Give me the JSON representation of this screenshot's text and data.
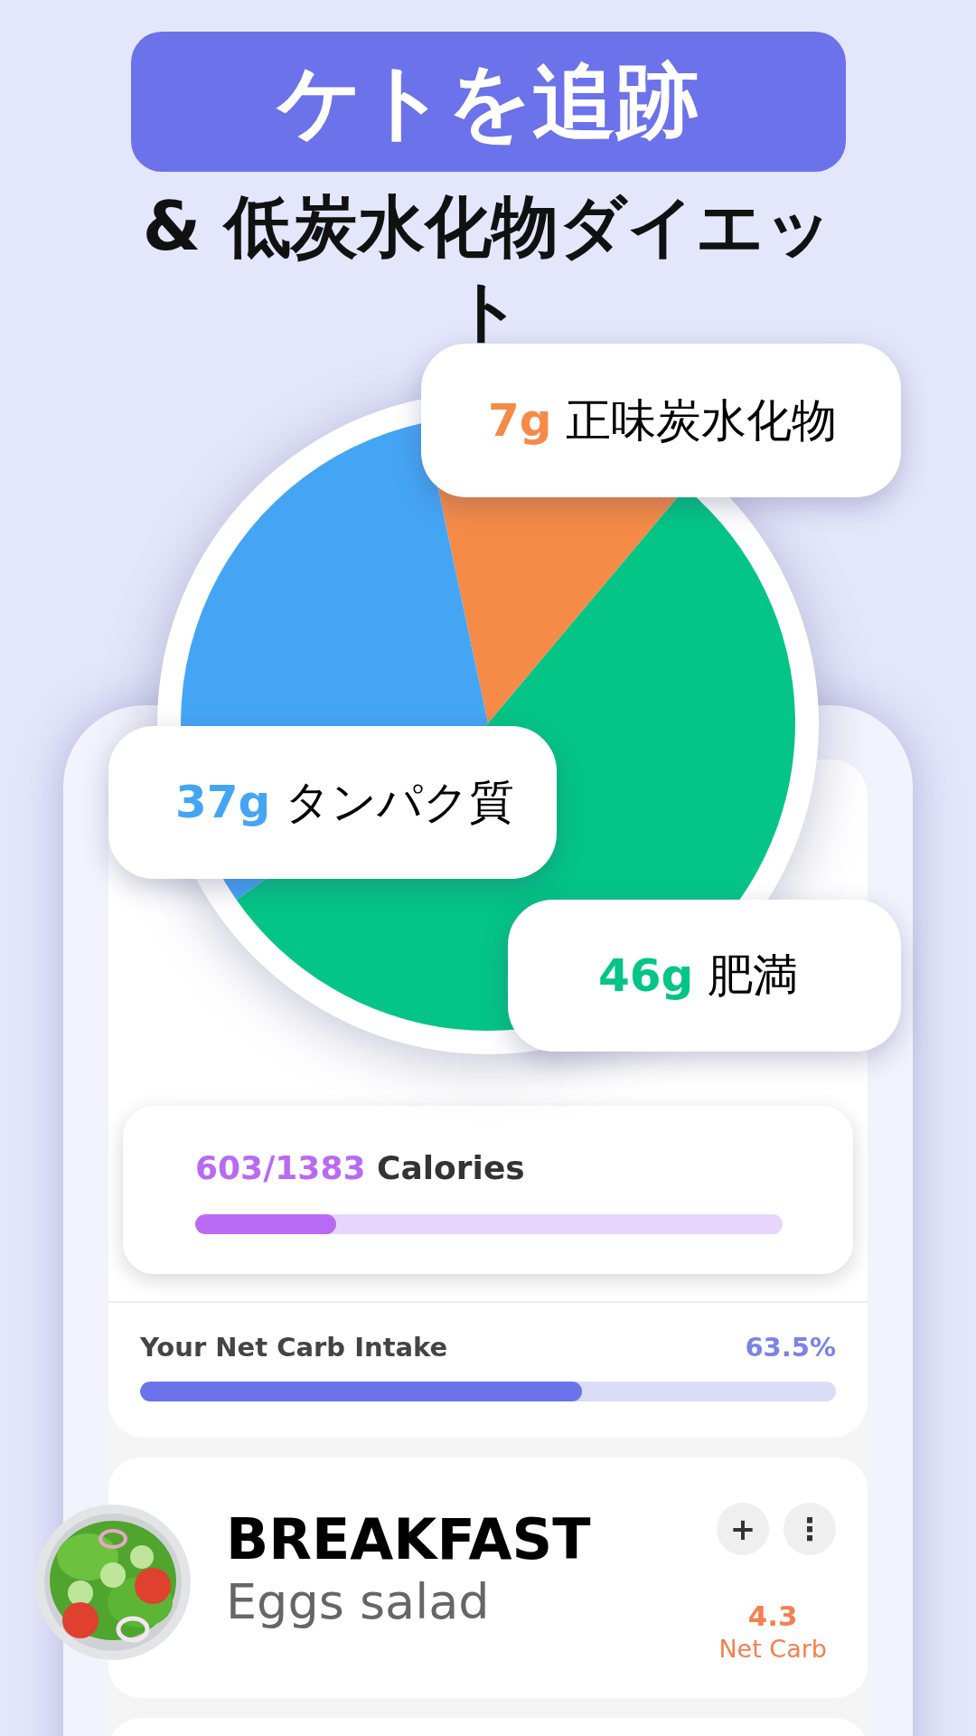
{
  "headline": "ケトを追跡",
  "subheadline": "& 低炭水化物ダイエット",
  "macros": [
    {
      "amount": "7g",
      "label": "正味炭水化物",
      "color": "#f58b47"
    },
    {
      "amount": "37g",
      "label": "タンパク質",
      "color": "#45a5f5"
    },
    {
      "amount": "46g",
      "label": "肥満",
      "color": "#04c585"
    }
  ],
  "calories": {
    "value": "603/1383",
    "label": "Calories",
    "level": 0.24
  },
  "net_carb_intake": {
    "label": "Your Net Carb Intake",
    "percent": "63.5%",
    "level": 0.635
  },
  "meals": [
    {
      "kind": "picture",
      "title": "BREAKFAST",
      "dish": "Eggs salad",
      "net_carb": "4.3",
      "net_carb_label": "Net Carb",
      "actions": [
        "+",
        "⋮"
      ]
    }
  ]
}
